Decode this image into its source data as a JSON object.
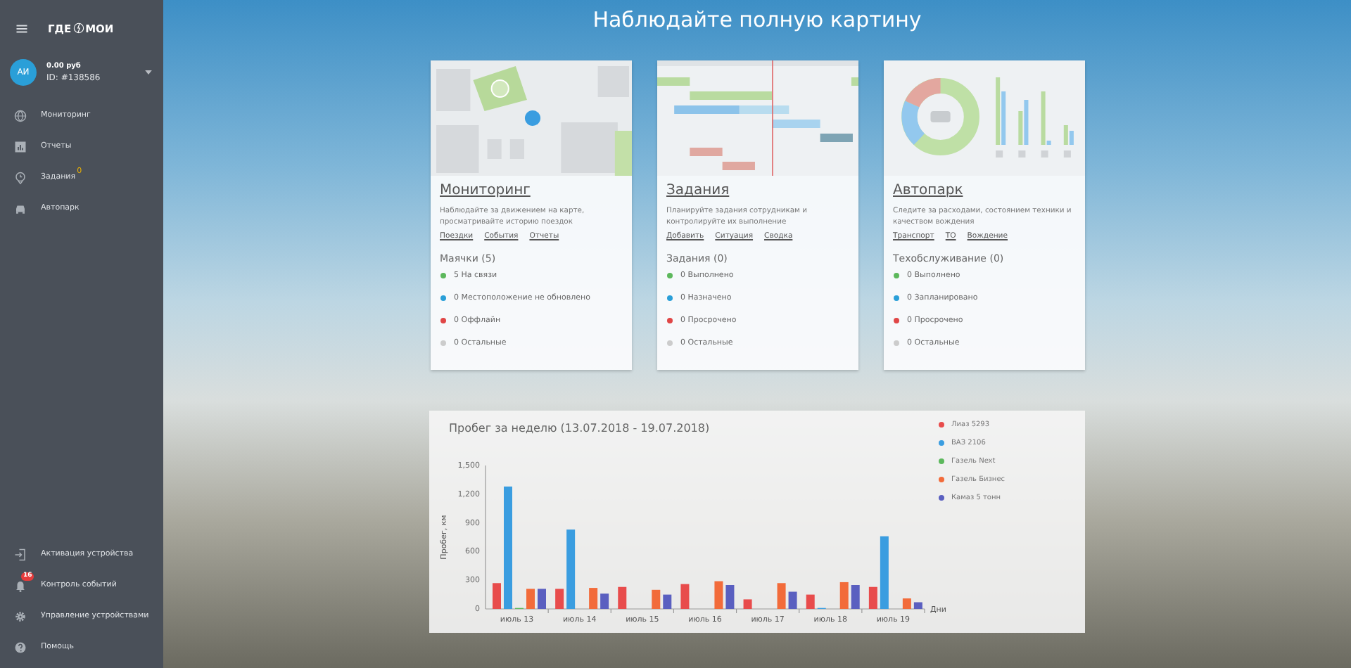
{
  "sidebar": {
    "logo": {
      "left": "ГДЕ",
      "right": "МОИ"
    },
    "account": {
      "avatar": "АИ",
      "balance": "0.00 руб",
      "id": "ID: #138586"
    },
    "items": [
      {
        "label": "Мониторинг",
        "kind": "globe"
      },
      {
        "label": "Отчеты",
        "kind": "report"
      },
      {
        "label": "Задания",
        "kind": "pin",
        "badge": "0"
      },
      {
        "label": "Автопарк",
        "kind": "car"
      }
    ],
    "bottom_items": [
      {
        "label": "Активация устройства",
        "kind": "login"
      },
      {
        "label": "Контроль событий",
        "kind": "bell",
        "badge": "16"
      },
      {
        "label": "Управление устройствами",
        "kind": "gear"
      },
      {
        "label": "Помощь",
        "kind": "help"
      }
    ]
  },
  "title": "Наблюдайте полную картину",
  "cards": [
    {
      "kind": "map",
      "title": "Мониторинг",
      "description": "Наблюдайте за движением на карте, просматривайте историю поездок",
      "links": [
        "Поездки",
        "События",
        "Отчеты"
      ],
      "status_title": "Маячки (5)",
      "statuses": [
        {
          "label": "5 На связи",
          "color": "#5cb85c"
        },
        {
          "label": "0 Местоположение не обновлено",
          "color": "#2a9fd8"
        },
        {
          "label": "0 Оффлайн",
          "color": "#e04646"
        },
        {
          "label": "0 Остальные",
          "color": "#cccccc"
        }
      ]
    },
    {
      "kind": "gantt",
      "title": "Задания",
      "description": "Планируйте задания сотрудникам и контролируйте их выполнение",
      "links": [
        "Добавить",
        "Ситуация",
        "Сводка"
      ],
      "status_title": "Задания (0)",
      "statuses": [
        {
          "label": "0 Выполнено",
          "color": "#5cb85c"
        },
        {
          "label": "0 Назначено",
          "color": "#2a9fd8"
        },
        {
          "label": "0 Просрочено",
          "color": "#e04646"
        },
        {
          "label": "0 Остальные",
          "color": "#cccccc"
        }
      ]
    },
    {
      "kind": "donut",
      "title": "Автопарк",
      "description": "Следите за расходами, состоянием техники и качеством вождения",
      "links": [
        "Транспорт",
        "ТО",
        "Вождение"
      ],
      "status_title": "Техобслуживание (0)",
      "statuses": [
        {
          "label": "0 Выполнено",
          "color": "#5cb85c"
        },
        {
          "label": "0 Запланировано",
          "color": "#2a9fd8"
        },
        {
          "label": "0 Просрочено",
          "color": "#e04646"
        },
        {
          "label": "0 Остальные",
          "color": "#cccccc"
        }
      ]
    }
  ],
  "mileage": {
    "chart_data": {
      "type": "bar",
      "title": "Пробег за неделю (13.07.2018 - 19.07.2018)",
      "xlabel": "Дни",
      "ylabel": "Пробег, км",
      "categories": [
        "июль 13",
        "июль 14",
        "июль 15",
        "июль 16",
        "июль 17",
        "июль 18",
        "июль 19"
      ],
      "ylim": [
        0,
        1500
      ],
      "yticks": [
        0,
        {
          "value": 300,
          "label": "300"
        },
        {
          "value": 600,
          "label": "600"
        },
        {
          "value": 900,
          "label": "900"
        },
        {
          "value": 1200,
          "label": "1,200"
        },
        {
          "value": 1500,
          "label": "1,500"
        }
      ],
      "series": [
        {
          "name": "Лиаз 5293",
          "color": "#e84c4c",
          "values": [
            270,
            210,
            230,
            260,
            100,
            150,
            230
          ]
        },
        {
          "name": "ВАЗ 2106",
          "color": "#3a9de0",
          "values": [
            1280,
            830,
            0,
            0,
            0,
            10,
            760
          ]
        },
        {
          "name": "Газель Next",
          "color": "#5cb85c",
          "values": [
            10,
            0,
            0,
            0,
            0,
            0,
            0
          ]
        },
        {
          "name": "Газель Бизнес",
          "color": "#f26b3a",
          "values": [
            210,
            220,
            200,
            290,
            270,
            280,
            110
          ]
        },
        {
          "name": "Камаз 5 тонн",
          "color": "#5a5fc0",
          "values": [
            210,
            160,
            150,
            250,
            180,
            250,
            70
          ]
        }
      ]
    }
  }
}
